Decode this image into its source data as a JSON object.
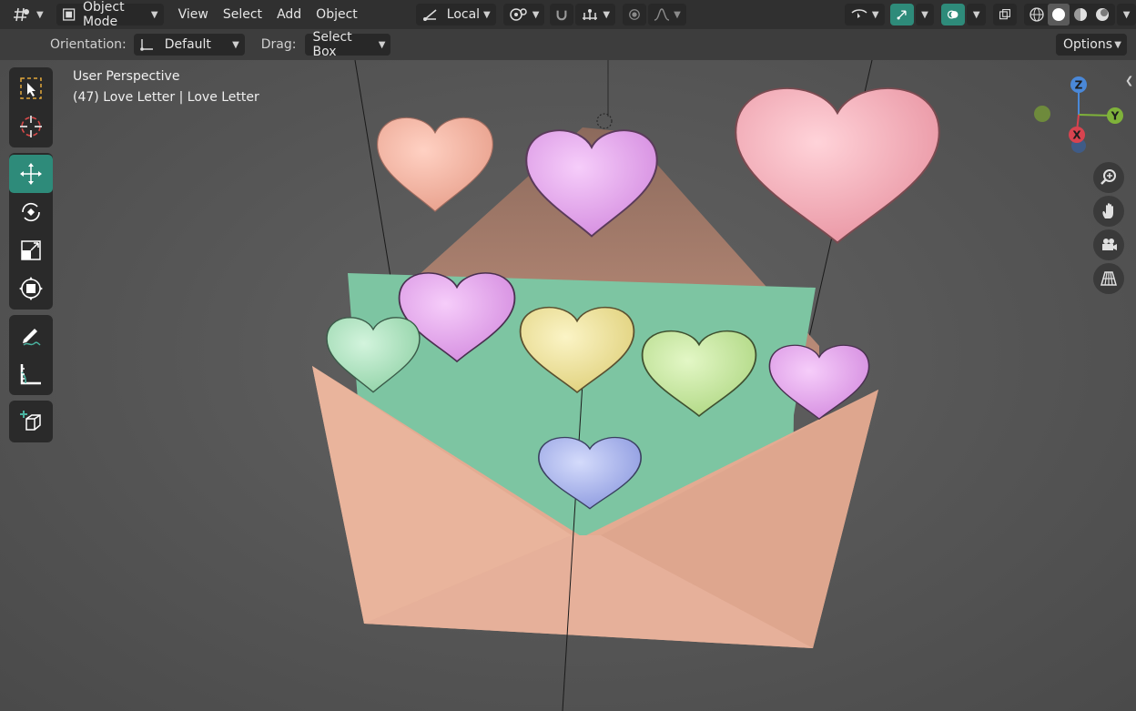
{
  "header": {
    "mode_label": "Object Mode",
    "menus": [
      "View",
      "Select",
      "Add",
      "Object"
    ],
    "transform_orientation": "Local"
  },
  "subheader": {
    "orientation_label": "Orientation:",
    "orientation_value": "Default",
    "drag_label": "Drag:",
    "drag_value": "Select Box",
    "options_label": "Options"
  },
  "viewport": {
    "perspective_label": "User Perspective",
    "object_info": "(47) Love Letter | Love Letter"
  },
  "gizmo": {
    "z": "Z",
    "y": "Y",
    "x": "X"
  },
  "colors": {
    "accent": "#2e8b7a",
    "header_bg": "#303030",
    "viewport_bg": "#595959",
    "envelope": "#e5ad94",
    "letter": "#7fc6a4",
    "heart_pink": "#f3a9b4",
    "heart_peach": "#f6b3a0",
    "heart_purple": "#e6a6ee",
    "heart_yellow": "#f0e39a",
    "heart_green": "#c6e89a",
    "heart_mint": "#a9e3bd",
    "heart_blue": "#a8b4ee"
  }
}
